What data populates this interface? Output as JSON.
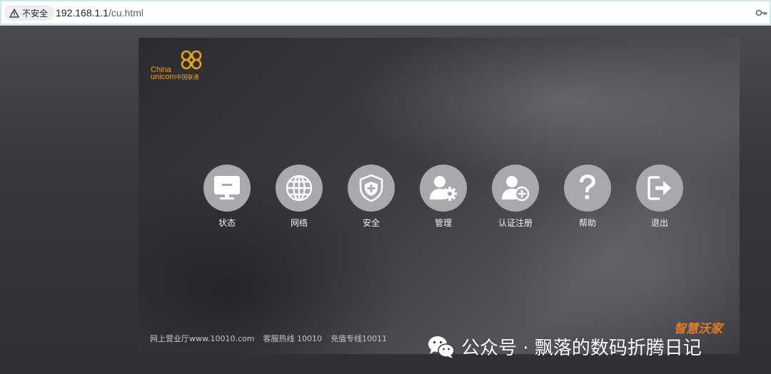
{
  "browser": {
    "security_label": "不安全",
    "url_host": "192.168.1.1",
    "url_path": "/cu.html"
  },
  "brand": {
    "line1": "China",
    "line2": "unicom",
    "line2_cn": "中国联通",
    "color": "#e8a31c"
  },
  "menu": {
    "items": [
      {
        "label": "状态",
        "icon": "monitor-icon"
      },
      {
        "label": "网络",
        "icon": "globe-icon"
      },
      {
        "label": "安全",
        "icon": "shield-plus-icon"
      },
      {
        "label": "管理",
        "icon": "user-gear-icon"
      },
      {
        "label": "认证注册",
        "icon": "user-plus-icon"
      },
      {
        "label": "帮助",
        "icon": "question-icon"
      },
      {
        "label": "退出",
        "icon": "logout-icon"
      }
    ],
    "circle_color": "#a8a8ad"
  },
  "footer": {
    "website": "网上营业厅www.10010.com",
    "hotline": "客服热线 10010",
    "recharge": "充值专线10011"
  },
  "smart_brand": "智慧沃家",
  "watermark": "公众号 · 飘落的数码折腾日记"
}
